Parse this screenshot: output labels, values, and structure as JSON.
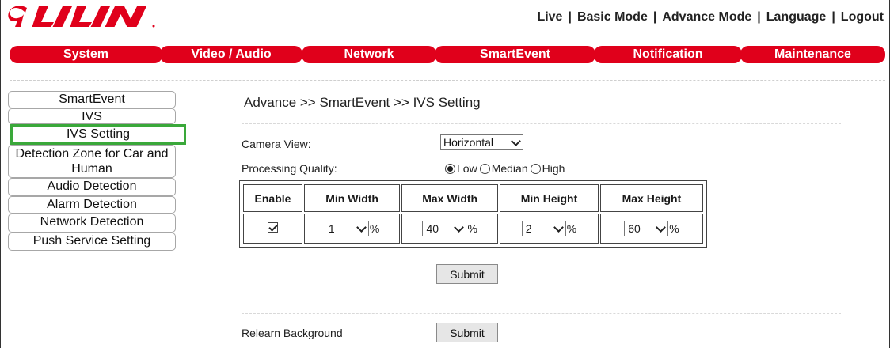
{
  "logo": {
    "text": "LILIN",
    "color": "#e0001b"
  },
  "topnav": {
    "items": [
      "Live",
      "Basic Mode",
      "Advance Mode",
      "Language",
      "Logout"
    ],
    "separator": "|"
  },
  "menu": {
    "color": "#e0001b",
    "tabs": [
      "System",
      "Video / Audio",
      "Network",
      "SmartEvent",
      "Notification",
      "Maintenance"
    ]
  },
  "sidebar": {
    "items": [
      {
        "label": "SmartEvent"
      },
      {
        "label": "IVS"
      },
      {
        "label": "IVS Setting",
        "selected": true
      },
      {
        "label": "Detection Zone for Car and Human"
      },
      {
        "label": "Audio Detection"
      },
      {
        "label": "Alarm Detection"
      },
      {
        "label": "Network Detection"
      },
      {
        "label": "Push Service Setting"
      }
    ],
    "highlight_color": "#3aa83a"
  },
  "breadcrumb": "Advance >> SmartEvent >> IVS Setting",
  "form": {
    "camera_view": {
      "label": "Camera View:",
      "value": "Horizontal"
    },
    "processing_quality": {
      "label": "Processing Quality:",
      "options": [
        "Low",
        "Median",
        "High"
      ],
      "selected": "Low"
    },
    "table": {
      "headers": [
        "Enable",
        "Min Width",
        "Max Width",
        "Min Height",
        "Max Height"
      ],
      "row": {
        "enable": true,
        "min_width": "1",
        "max_width": "40",
        "min_height": "2",
        "max_height": "60",
        "unit": "%"
      }
    },
    "submit_label": "Submit",
    "relearn": {
      "label": "Relearn Background",
      "button": "Submit"
    }
  }
}
